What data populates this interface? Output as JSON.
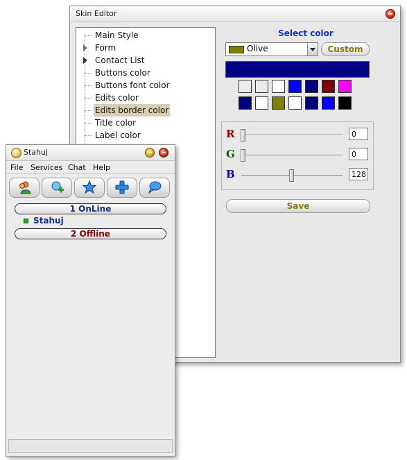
{
  "skin_editor": {
    "title": "Skin Editor",
    "tree_items": [
      {
        "label": "Main Style",
        "arrow": "none"
      },
      {
        "label": "Form",
        "arrow": "gray"
      },
      {
        "label": "Contact List",
        "arrow": "dark"
      },
      {
        "label": "Buttons color",
        "arrow": "none"
      },
      {
        "label": "Buttons font color",
        "arrow": "none"
      },
      {
        "label": "Edits color",
        "arrow": "none"
      },
      {
        "label": "Edits border color",
        "arrow": "none",
        "selected": true
      },
      {
        "label": "Title color",
        "arrow": "none"
      },
      {
        "label": "Label color",
        "arrow": "none"
      }
    ],
    "select_color_title": "Select color",
    "color_combo": {
      "value": "Olive",
      "swatch": "#7f7f00"
    },
    "custom_label": "Custom",
    "preview_color": "#000080",
    "palette": [
      [
        "#ececec",
        "#ececec",
        "#ffffff",
        "#0000ff",
        "#000080",
        "#800000",
        "#ff00ff"
      ],
      [
        "#000080",
        "#ffffff",
        "#808000",
        "#ffffff",
        "#000080",
        "#0000ff",
        "#000000"
      ]
    ],
    "rgb": [
      {
        "letter": "R",
        "value": "0",
        "color": "#8b0000",
        "level": 0
      },
      {
        "letter": "G",
        "value": "0",
        "color": "#006400",
        "level": 0
      },
      {
        "letter": "B",
        "value": "128",
        "color": "#00007f",
        "level": 0.5
      }
    ],
    "save_label": "Save"
  },
  "stahuj": {
    "title": "Stahuj",
    "menu": [
      "File",
      "Services",
      "Chat",
      "Help"
    ],
    "toolbar_icons": [
      "users-icon",
      "add-contact-icon",
      "star-icon",
      "plus-icon",
      "chat-icon"
    ],
    "groups": [
      {
        "label": "1  OnLine",
        "color": "#1a2a90"
      },
      {
        "label": "2  Offline",
        "color": "#8b0000"
      }
    ],
    "contacts": [
      {
        "name": "Stahuj"
      }
    ]
  }
}
